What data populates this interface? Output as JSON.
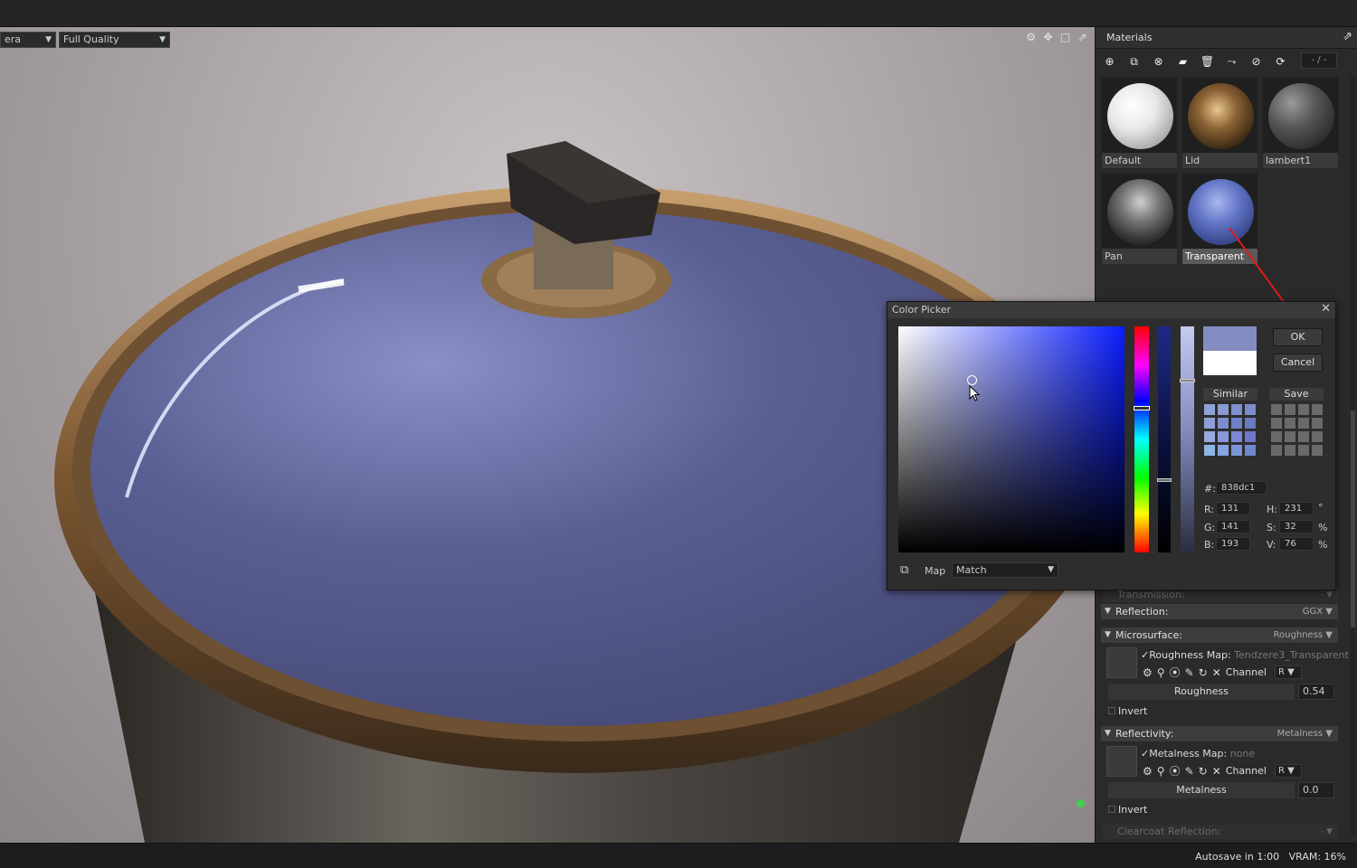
{
  "viewport": {
    "camera_select": "era",
    "quality_select": "Full Quality",
    "toolbar_icons": [
      "gear-icon",
      "move-icon",
      "maximize-icon",
      "popout-icon"
    ]
  },
  "materials_panel": {
    "title": "Materials",
    "page_field": "- / -",
    "toolbar_icons": [
      "add-material-icon",
      "duplicate-icon",
      "merge-icon",
      "folder-icon",
      "delete-icon",
      "select-icon",
      "check-icon",
      "refresh-icon"
    ],
    "materials": [
      {
        "name": "Default"
      },
      {
        "name": "Lid"
      },
      {
        "name": "lambert1"
      },
      {
        "name": "Pan"
      },
      {
        "name": "Transparent",
        "selected": true
      }
    ]
  },
  "properties": {
    "transmission_label": "Transmission:",
    "reflection": {
      "label": "Reflection:",
      "value": "GGX"
    },
    "microsurface": {
      "label": "Microsurface:",
      "value": "Roughness"
    },
    "roughness_map": {
      "label": "Roughness Map:",
      "file": "Tendzere3_Transparent",
      "channel_label": "Channel",
      "channel": "R"
    },
    "roughness": {
      "label": "Roughness",
      "value": "0.54"
    },
    "roughness_invert": "Invert",
    "reflectivity": {
      "label": "Reflectivity:",
      "value": "Metalness"
    },
    "metalness_map": {
      "label": "Metalness Map:",
      "file": "none",
      "channel_label": "Channel",
      "channel": "R"
    },
    "metalness": {
      "label": "Metalness",
      "value": "0.0"
    },
    "metalness_invert": "Invert",
    "clearcoat_label": "Clearcoat Reflection:",
    "clearcoat_value": "-"
  },
  "color_picker": {
    "title": "Color Picker",
    "ok_label": "OK",
    "cancel_label": "Cancel",
    "similar_label": "Similar",
    "save_label": "Save",
    "current_color": "#838dc1",
    "previous_color": "#ffffff",
    "hex_label": "#:",
    "hex": "838dc1",
    "r_label": "R:",
    "r": "131",
    "g_label": "G:",
    "g": "141",
    "b_label": "B:",
    "b": "193",
    "h_label": "H:",
    "h": "231",
    "h_unit": "°",
    "s_label": "S:",
    "s": "32",
    "s_unit": "%",
    "v_label": "V:",
    "v": "76",
    "v_unit": "%",
    "map_label": "Map",
    "map_value": "Match",
    "similar_swatches": [
      "#8fa3d8",
      "#8a9bd4",
      "#7f91cf",
      "#7a8ccc",
      "#8e9fd6",
      "#7c8dcd",
      "#6f80c7",
      "#6a7bc4",
      "#9aa8e0",
      "#8996d9",
      "#7d87d3",
      "#6e76cc",
      "#8fb4e6",
      "#83a4df",
      "#7a96d8",
      "#6d88d0"
    ],
    "saved_swatches": [
      "#6a6a6a",
      "#6a6a6a",
      "#6a6a6a",
      "#6a6a6a",
      "#6a6a6a",
      "#6a6a6a",
      "#6a6a6a",
      "#6a6a6a",
      "#6a6a6a",
      "#6a6a6a",
      "#6a6a6a",
      "#6a6a6a",
      "#6a6a6a",
      "#6a6a6a",
      "#6a6a6a",
      "#6a6a6a"
    ]
  },
  "status": {
    "autosave": "Autosave in 1:00",
    "vram": "VRAM: 16%"
  }
}
